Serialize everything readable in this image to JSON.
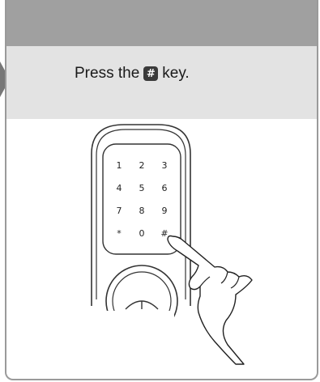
{
  "instruction": {
    "prefix": "Press the",
    "key_symbol": "#",
    "suffix": "key."
  },
  "keypad": {
    "keys": [
      "1",
      "2",
      "3",
      "4",
      "5",
      "6",
      "7",
      "8",
      "9",
      "*",
      "0",
      "#"
    ]
  },
  "colors": {
    "header": "#a0a0a0",
    "instruction_band": "#e3e3e3",
    "keycap": "#3a3a3a"
  }
}
